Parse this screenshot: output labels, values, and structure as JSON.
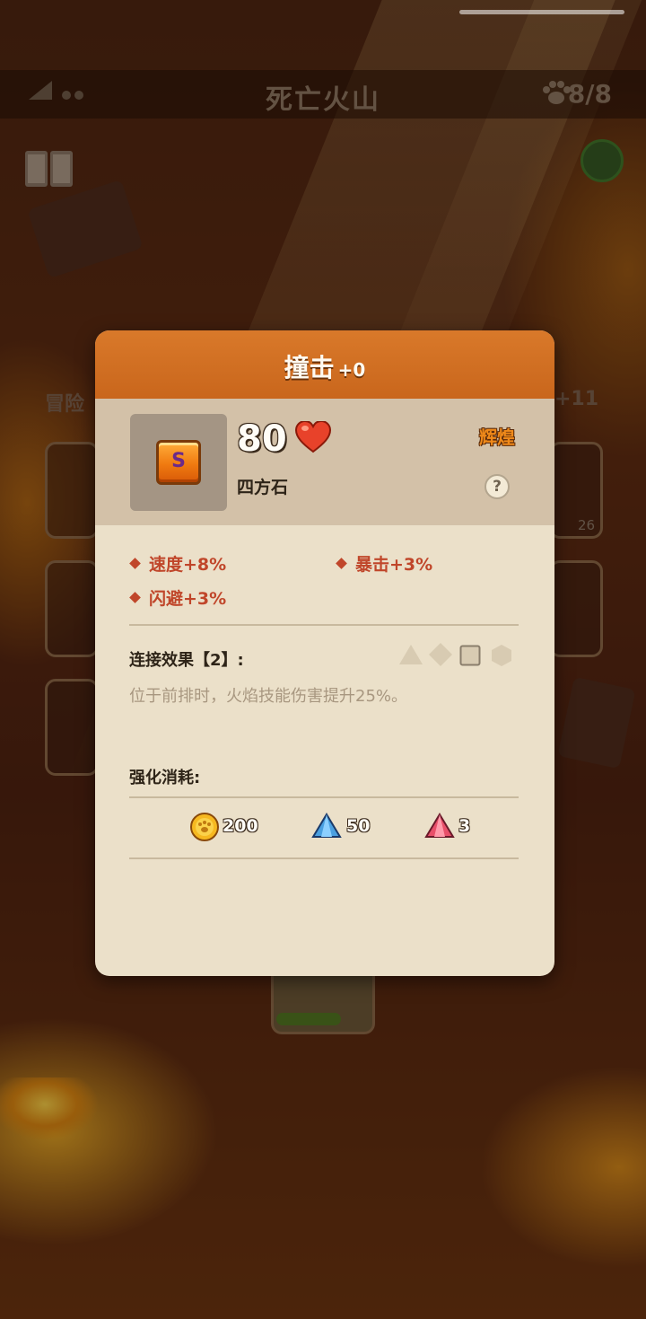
{
  "background": {
    "level_title": "死亡火山",
    "paw_count": "8/8",
    "side_label_left": "冒险",
    "side_label_right": "+11",
    "side_count": "26"
  },
  "modal": {
    "title": "撞击",
    "level": "+0",
    "item": {
      "gem_letter": "S",
      "power": "80",
      "name": "四方石",
      "rarity": "辉煌",
      "help_label": "?"
    },
    "stats": [
      {
        "label": "速度+8%"
      },
      {
        "label": "暴击+3%"
      },
      {
        "label": "闪避+3%"
      }
    ],
    "link_effect": {
      "label": "连接效果【2】:",
      "shapes": [
        "triangle-icon",
        "diamond-icon",
        "square-icon",
        "hexagon-icon"
      ],
      "description": "位于前排时，火焰技能伤害提升25%。"
    },
    "upgrade_cost": {
      "label": "强化消耗:",
      "items": [
        {
          "icon": "coin-icon",
          "value": "200"
        },
        {
          "icon": "blue-crystal-icon",
          "value": "50"
        },
        {
          "icon": "red-crystal-icon",
          "value": "3"
        }
      ]
    }
  },
  "colors": {
    "header": "#d9792a",
    "stat_text": "#c0462a",
    "rarity": "#f08a1a",
    "modal_bg": "#ebe0c9"
  }
}
